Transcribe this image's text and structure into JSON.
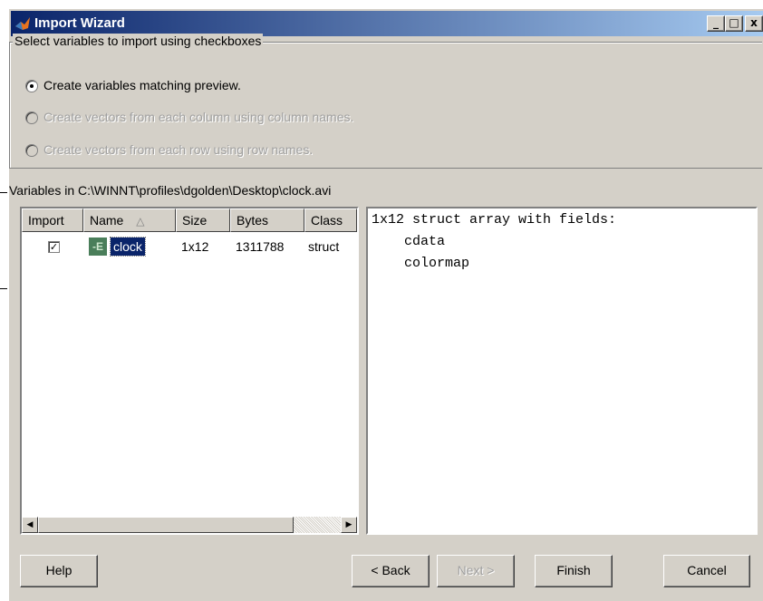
{
  "window": {
    "title": "Import Wizard",
    "minimize_glyph": "_",
    "maximize_glyph": "□",
    "close_glyph": "x"
  },
  "import_options": {
    "legend": "Select variables to import using checkboxes",
    "options": [
      {
        "label": "Create variables matching preview.",
        "selected": true,
        "enabled": true
      },
      {
        "label": "Create vectors from each column using column names.",
        "selected": false,
        "enabled": false
      },
      {
        "label": "Create vectors from each row using row names.",
        "selected": false,
        "enabled": false
      }
    ]
  },
  "variables": {
    "label": "Variables in C:\\WINNT\\profiles\\dgolden\\Desktop\\clock.avi",
    "columns": [
      "Import",
      "Name",
      "Size",
      "Bytes",
      "Class"
    ],
    "sort_indicator": "△",
    "rows": [
      {
        "import_checked": true,
        "check_glyph": "✓",
        "icon": "struct-icon",
        "icon_glyph": "-E",
        "name": "clock",
        "size": "1x12",
        "bytes": "1311788",
        "class": "struct"
      }
    ]
  },
  "preview": {
    "lines": [
      "1x12 struct array with fields:",
      "    cdata",
      "    colormap"
    ]
  },
  "buttons": {
    "help": "Help",
    "back": "< Back",
    "next": "Next >",
    "finish": "Finish",
    "cancel": "Cancel",
    "scroll_left": "◀",
    "scroll_right": "▶"
  },
  "colors": {
    "title_gradient_start": "#0a246a",
    "title_gradient_end": "#a6caf0",
    "face": "#d4d0c8",
    "selection": "#0a246a",
    "struct_icon": "#4a7e5a"
  }
}
